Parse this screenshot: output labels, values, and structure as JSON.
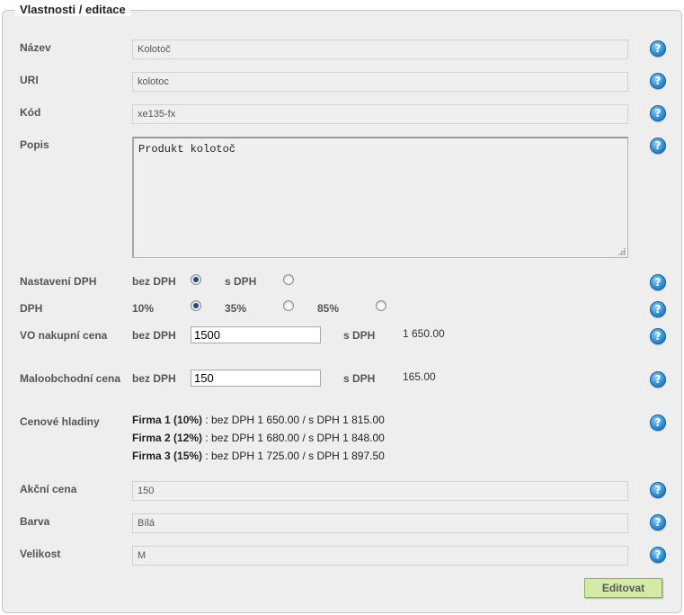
{
  "panel": {
    "title": "Vlastnosti / editace"
  },
  "fields": {
    "nazev": {
      "label": "Název",
      "value": "Kolotoč"
    },
    "uri": {
      "label": "URI",
      "value": "kolotoc"
    },
    "kod": {
      "label": "Kód",
      "value": "xe135-fx"
    },
    "popis": {
      "label": "Popis",
      "value": "Produkt kolotoč"
    }
  },
  "vat_setting": {
    "label": "Nastavení DPH",
    "options": [
      {
        "label": "bez DPH",
        "selected": true
      },
      {
        "label": "s DPH",
        "selected": false
      }
    ]
  },
  "vat_rate": {
    "label": "DPH",
    "options": [
      {
        "label": "10%",
        "selected": true
      },
      {
        "label": "35%",
        "selected": false
      },
      {
        "label": "85%",
        "selected": false
      }
    ]
  },
  "wholesale": {
    "label": "VO nakupní cena",
    "net_label": "bez DPH",
    "net_value": "1500",
    "gross_label": "s DPH",
    "gross_value": "1 650.00"
  },
  "retail": {
    "label": "Maloobchodní cena",
    "net_label": "bez DPH",
    "net_value": "150",
    "gross_label": "s DPH",
    "gross_value": "165.00"
  },
  "price_levels": {
    "label": "Cenové hladiny",
    "tiers": [
      {
        "name": "Firma 1 (10%)",
        "text": ": bez DPH 1 650.00 / s DPH 1 815.00"
      },
      {
        "name": "Firma 2 (12%)",
        "text": ": bez DPH 1 680.00 / s DPH 1 848.00"
      },
      {
        "name": "Firma 3 (15%)",
        "text": ": bez DPH 1 725.00 / s DPH 1 897.50"
      }
    ]
  },
  "attributes": {
    "akcni_cena": {
      "label": "Akční cena",
      "value": "150"
    },
    "barva": {
      "label": "Barva",
      "value": "Bílá"
    },
    "velikost": {
      "label": "Velikost",
      "value": "M"
    }
  },
  "help_icon": {
    "glyph": "?",
    "icon": "help-icon"
  },
  "actions": {
    "edit_label": "Editovat"
  },
  "colors": {
    "button_bg": "#d4eaa6",
    "help_blue": "#2f8fd8",
    "panel_bg": "#eeeeee"
  }
}
